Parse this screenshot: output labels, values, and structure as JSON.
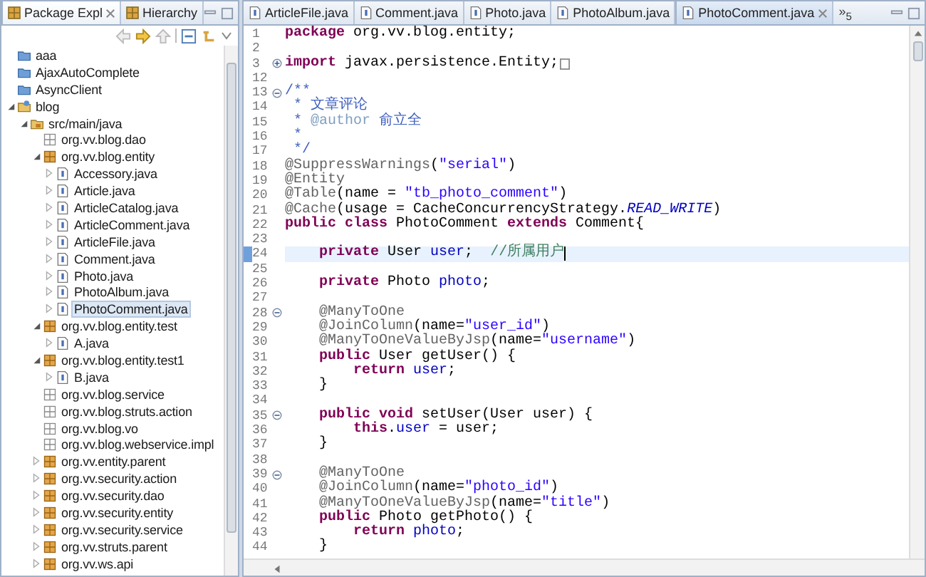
{
  "explorer": {
    "tabs": [
      {
        "label": "Package Expl",
        "selected": true
      },
      {
        "label": "Hierarchy",
        "selected": false
      }
    ],
    "tree": [
      {
        "label": "aaa",
        "kind": "closed-project",
        "selected": false
      },
      {
        "label": "AjaxAutoComplete",
        "kind": "closed-project",
        "selected": false
      },
      {
        "label": "AsyncClient",
        "kind": "closed-project",
        "selected": false
      },
      {
        "label": "blog",
        "kind": "project",
        "selected": false,
        "expanded": true,
        "children": [
          {
            "label": "src/main/java",
            "kind": "source-folder",
            "selected": false,
            "expanded": true,
            "children": [
              {
                "label": "org.vv.blog.dao",
                "kind": "empty-package",
                "selected": false
              },
              {
                "label": "org.vv.blog.entity",
                "kind": "package",
                "selected": false,
                "expanded": true,
                "children": [
                  {
                    "label": "Accessory.java",
                    "kind": "java-file",
                    "selected": false,
                    "expanded": false
                  },
                  {
                    "label": "Article.java",
                    "kind": "java-file",
                    "selected": false,
                    "expanded": false
                  },
                  {
                    "label": "ArticleCatalog.java",
                    "kind": "java-file",
                    "selected": false,
                    "expanded": false
                  },
                  {
                    "label": "ArticleComment.java",
                    "kind": "java-file",
                    "selected": false,
                    "expanded": false
                  },
                  {
                    "label": "ArticleFile.java",
                    "kind": "java-file",
                    "selected": false,
                    "expanded": false
                  },
                  {
                    "label": "Comment.java",
                    "kind": "java-file",
                    "selected": false,
                    "expanded": false
                  },
                  {
                    "label": "Photo.java",
                    "kind": "java-file",
                    "selected": false,
                    "expanded": false
                  },
                  {
                    "label": "PhotoAlbum.java",
                    "kind": "java-file",
                    "selected": false,
                    "expanded": false
                  },
                  {
                    "label": "PhotoComment.java",
                    "kind": "java-file",
                    "selected": true,
                    "expanded": false
                  }
                ]
              },
              {
                "label": "org.vv.blog.entity.test",
                "kind": "package",
                "selected": false,
                "expanded": true,
                "children": [
                  {
                    "label": "A.java",
                    "kind": "java-file",
                    "selected": false,
                    "expanded": false
                  }
                ]
              },
              {
                "label": "org.vv.blog.entity.test1",
                "kind": "package",
                "selected": false,
                "expanded": true,
                "children": [
                  {
                    "label": "B.java",
                    "kind": "java-file",
                    "selected": false,
                    "expanded": false
                  }
                ]
              },
              {
                "label": "org.vv.blog.service",
                "kind": "empty-package",
                "selected": false
              },
              {
                "label": "org.vv.blog.struts.action",
                "kind": "empty-package",
                "selected": false
              },
              {
                "label": "org.vv.blog.vo",
                "kind": "empty-package",
                "selected": false
              },
              {
                "label": "org.vv.blog.webservice.impl",
                "kind": "empty-package",
                "selected": false
              },
              {
                "label": "org.vv.entity.parent",
                "kind": "package",
                "selected": false,
                "expanded": false
              },
              {
                "label": "org.vv.security.action",
                "kind": "package",
                "selected": false,
                "expanded": false
              },
              {
                "label": "org.vv.security.dao",
                "kind": "package",
                "selected": false,
                "expanded": false
              },
              {
                "label": "org.vv.security.entity",
                "kind": "package",
                "selected": false,
                "expanded": false
              },
              {
                "label": "org.vv.security.service",
                "kind": "package",
                "selected": false,
                "expanded": false
              },
              {
                "label": "org.vv.struts.parent",
                "kind": "package",
                "selected": false,
                "expanded": false
              },
              {
                "label": "org.vv.ws.api",
                "kind": "package",
                "selected": false,
                "expanded": false
              }
            ]
          }
        ]
      }
    ]
  },
  "editor": {
    "tabs": [
      {
        "label": "ArticleFile.java",
        "selected": false
      },
      {
        "label": "Comment.java",
        "selected": false
      },
      {
        "label": "Photo.java",
        "selected": false
      },
      {
        "label": "PhotoAlbum.java",
        "selected": false
      },
      {
        "label": "PhotoComment.java",
        "selected": true
      }
    ],
    "overflow": "»$_{5}$",
    "lines": [
      {
        "number": "1",
        "current": false,
        "segments": [
          {
            "kind": "keyword",
            "text": "package"
          },
          {
            "kind": "plain",
            "text": " org.vv.blog.entity;"
          }
        ]
      },
      {
        "number": "2",
        "current": false
      },
      {
        "number": "3",
        "current": false,
        "collapsed": true,
        "segments": [
          {
            "kind": "keyword",
            "text": "import"
          },
          {
            "kind": "plain",
            "text": " javax.persistence.Entity;"
          }
        ]
      },
      {
        "number": "12",
        "current": false
      },
      {
        "number": "13",
        "current": false,
        "collapsed": false,
        "segments": [
          {
            "kind": "javadoc",
            "text": "/**"
          }
        ]
      },
      {
        "number": "14",
        "current": false,
        "segments": [
          {
            "kind": "javadoc",
            "text": " * 文章评论"
          }
        ]
      },
      {
        "number": "15",
        "current": false,
        "segments": [
          {
            "kind": "javadoc",
            "text": " * "
          },
          {
            "kind": "javadoc-tag",
            "text": "@author"
          },
          {
            "kind": "javadoc",
            "text": " 俞立全"
          }
        ]
      },
      {
        "number": "16",
        "current": false,
        "segments": [
          {
            "kind": "javadoc",
            "text": " *"
          }
        ]
      },
      {
        "number": "17",
        "current": false,
        "segments": [
          {
            "kind": "javadoc",
            "text": " */"
          }
        ]
      },
      {
        "number": "18",
        "current": false,
        "segments": [
          {
            "kind": "annotation",
            "text": "@SuppressWarnings"
          },
          {
            "kind": "plain",
            "text": "("
          },
          {
            "kind": "string",
            "text": "\"serial\""
          },
          {
            "kind": "plain",
            "text": ")"
          }
        ]
      },
      {
        "number": "19",
        "current": false,
        "segments": [
          {
            "kind": "annotation",
            "text": "@Entity"
          }
        ]
      },
      {
        "number": "20",
        "current": false,
        "segments": [
          {
            "kind": "annotation",
            "text": "@Table"
          },
          {
            "kind": "plain",
            "text": "(name = "
          },
          {
            "kind": "string",
            "text": "\"tb_photo_comment\""
          },
          {
            "kind": "plain",
            "text": ")"
          }
        ]
      },
      {
        "number": "21",
        "current": false,
        "segments": [
          {
            "kind": "annotation",
            "text": "@Cache"
          },
          {
            "kind": "plain",
            "text": "(usage = CacheConcurrencyStrategy."
          },
          {
            "kind": "static",
            "text": "READ_WRITE"
          },
          {
            "kind": "plain",
            "text": ")"
          }
        ]
      },
      {
        "number": "22",
        "current": false,
        "segments": [
          {
            "kind": "keyword",
            "text": "public class"
          },
          {
            "kind": "plain",
            "text": " PhotoComment "
          },
          {
            "kind": "keyword",
            "text": "extends"
          },
          {
            "kind": "plain",
            "text": " Comment{"
          }
        ]
      },
      {
        "number": "23",
        "current": false
      },
      {
        "number": "24",
        "current": true,
        "segments": [
          {
            "kind": "keyword",
            "text": "    private"
          },
          {
            "kind": "plain",
            "text": " User "
          },
          {
            "kind": "field",
            "text": "user"
          },
          {
            "kind": "plain",
            "text": ";  "
          },
          {
            "kind": "comment",
            "text": "//所属用户"
          }
        ]
      },
      {
        "number": "25",
        "current": false
      },
      {
        "number": "26",
        "current": false,
        "segments": [
          {
            "kind": "keyword",
            "text": "    private"
          },
          {
            "kind": "plain",
            "text": " Photo "
          },
          {
            "kind": "field",
            "text": "photo"
          },
          {
            "kind": "plain",
            "text": ";"
          }
        ]
      },
      {
        "number": "27",
        "current": false
      },
      {
        "number": "28",
        "current": false,
        "collapsed": false,
        "segments": [
          {
            "kind": "annotation",
            "text": "    @ManyToOne"
          }
        ]
      },
      {
        "number": "29",
        "current": false,
        "segments": [
          {
            "kind": "annotation",
            "text": "    @JoinColumn"
          },
          {
            "kind": "plain",
            "text": "(name="
          },
          {
            "kind": "string",
            "text": "\"user_id\""
          },
          {
            "kind": "plain",
            "text": ")"
          }
        ]
      },
      {
        "number": "30",
        "current": false,
        "segments": [
          {
            "kind": "annotation",
            "text": "    @ManyToOneValueByJsp"
          },
          {
            "kind": "plain",
            "text": "(name="
          },
          {
            "kind": "string",
            "text": "\"username\""
          },
          {
            "kind": "plain",
            "text": ")"
          }
        ]
      },
      {
        "number": "31",
        "current": false,
        "segments": [
          {
            "kind": "keyword",
            "text": "    public"
          },
          {
            "kind": "plain",
            "text": " User getUser() {"
          }
        ]
      },
      {
        "number": "32",
        "current": false,
        "segments": [
          {
            "kind": "keyword",
            "text": "        return"
          },
          {
            "kind": "field",
            "text": " user"
          },
          {
            "kind": "plain",
            "text": ";"
          }
        ]
      },
      {
        "number": "33",
        "current": false,
        "segments": [
          {
            "kind": "plain",
            "text": "    }"
          }
        ]
      },
      {
        "number": "34",
        "current": false
      },
      {
        "number": "35",
        "current": false,
        "collapsed": false,
        "segments": [
          {
            "kind": "keyword",
            "text": "    public void"
          },
          {
            "kind": "plain",
            "text": " setUser(User user) {"
          }
        ]
      },
      {
        "number": "36",
        "current": false,
        "segments": [
          {
            "kind": "keyword",
            "text": "        this"
          },
          {
            "kind": "plain",
            "text": "."
          },
          {
            "kind": "field",
            "text": "user"
          },
          {
            "kind": "plain",
            "text": " = user;"
          }
        ]
      },
      {
        "number": "37",
        "current": false,
        "segments": [
          {
            "kind": "plain",
            "text": "    }"
          }
        ]
      },
      {
        "number": "38",
        "current": false
      },
      {
        "number": "39",
        "current": false,
        "collapsed": false,
        "segments": [
          {
            "kind": "annotation",
            "text": "    @ManyToOne"
          }
        ]
      },
      {
        "number": "40",
        "current": false,
        "segments": [
          {
            "kind": "annotation",
            "text": "    @JoinColumn"
          },
          {
            "kind": "plain",
            "text": "(name="
          },
          {
            "kind": "string",
            "text": "\"photo_id\""
          },
          {
            "kind": "plain",
            "text": ")"
          }
        ]
      },
      {
        "number": "41",
        "current": false,
        "segments": [
          {
            "kind": "annotation",
            "text": "    @ManyToOneValueByJsp"
          },
          {
            "kind": "plain",
            "text": "(name="
          },
          {
            "kind": "string",
            "text": "\"title\""
          },
          {
            "kind": "plain",
            "text": ")"
          }
        ]
      },
      {
        "number": "42",
        "current": false,
        "segments": [
          {
            "kind": "keyword",
            "text": "    public"
          },
          {
            "kind": "plain",
            "text": " Photo getPhoto() {"
          }
        ]
      },
      {
        "number": "43",
        "current": false,
        "segments": [
          {
            "kind": "keyword",
            "text": "        return"
          },
          {
            "kind": "field",
            "text": " photo"
          },
          {
            "kind": "plain",
            "text": ";"
          }
        ]
      },
      {
        "number": "44",
        "current": false,
        "segments": [
          {
            "kind": "plain",
            "text": "    }"
          }
        ]
      }
    ]
  }
}
